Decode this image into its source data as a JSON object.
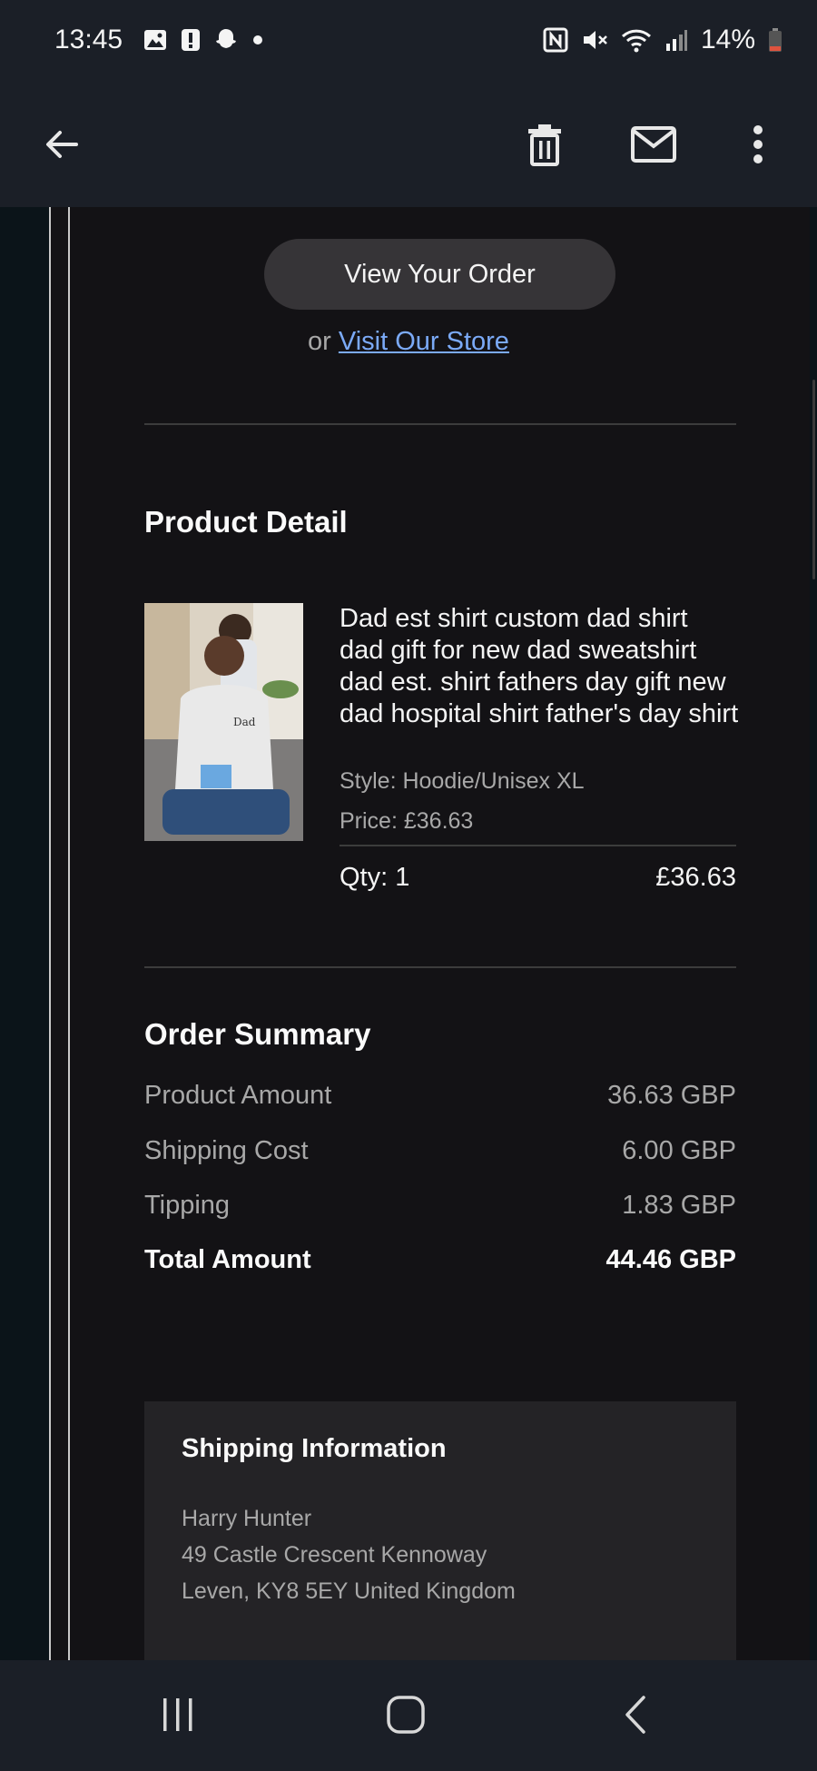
{
  "status_bar": {
    "time": "13:45",
    "left_icons": [
      "gallery-icon",
      "alert-icon",
      "snapchat-icon",
      "dot-icon"
    ],
    "right_icons": [
      "nfc-icon",
      "mute-icon",
      "wifi-icon",
      "signal-icon"
    ],
    "battery_text": "14%"
  },
  "app_bar": {
    "back_icon": "arrow-back-icon",
    "delete_icon": "trash-icon",
    "mail_icon": "mail-icon",
    "more_icon": "more-vert-icon"
  },
  "email": {
    "view_order_label": "View Your Order",
    "or_text": "or",
    "visit_store_label": "Visit Our Store",
    "product_section_title": "Product Detail",
    "product": {
      "name": "Dad est shirt custom dad shirt dad gift for new dad sweatshirt dad est. shirt fathers day gift new dad hospital shirt father's day shirt",
      "style": "Style: Hoodie/Unisex XL",
      "price_label": "Price:",
      "price": "£36.63",
      "qty": "Qty: 1",
      "line_total": "£36.63"
    },
    "summary_title": "Order Summary",
    "summary": [
      {
        "label": "Product Amount",
        "value": "36.63 GBP"
      },
      {
        "label": "Shipping Cost",
        "value": "6.00 GBP"
      },
      {
        "label": "Tipping",
        "value": "1.83 GBP"
      },
      {
        "label": "Total Amount",
        "value": "44.46 GBP"
      }
    ],
    "shipping": {
      "title": "Shipping Information",
      "name": "Harry Hunter",
      "address_line1": "49 Castle Crescent Kennoway",
      "address_line2": "Leven, KY8 5EY United Kingdom"
    }
  },
  "nav_bar": {
    "recents_icon": "recents-icon",
    "home_icon": "home-icon",
    "back_icon": "nav-back-icon"
  },
  "colors": {
    "bar_background": "#1b1f27",
    "content_background": "#131215",
    "link": "#7baaf7",
    "button": "#363437",
    "battery_low": "#e0533e"
  }
}
